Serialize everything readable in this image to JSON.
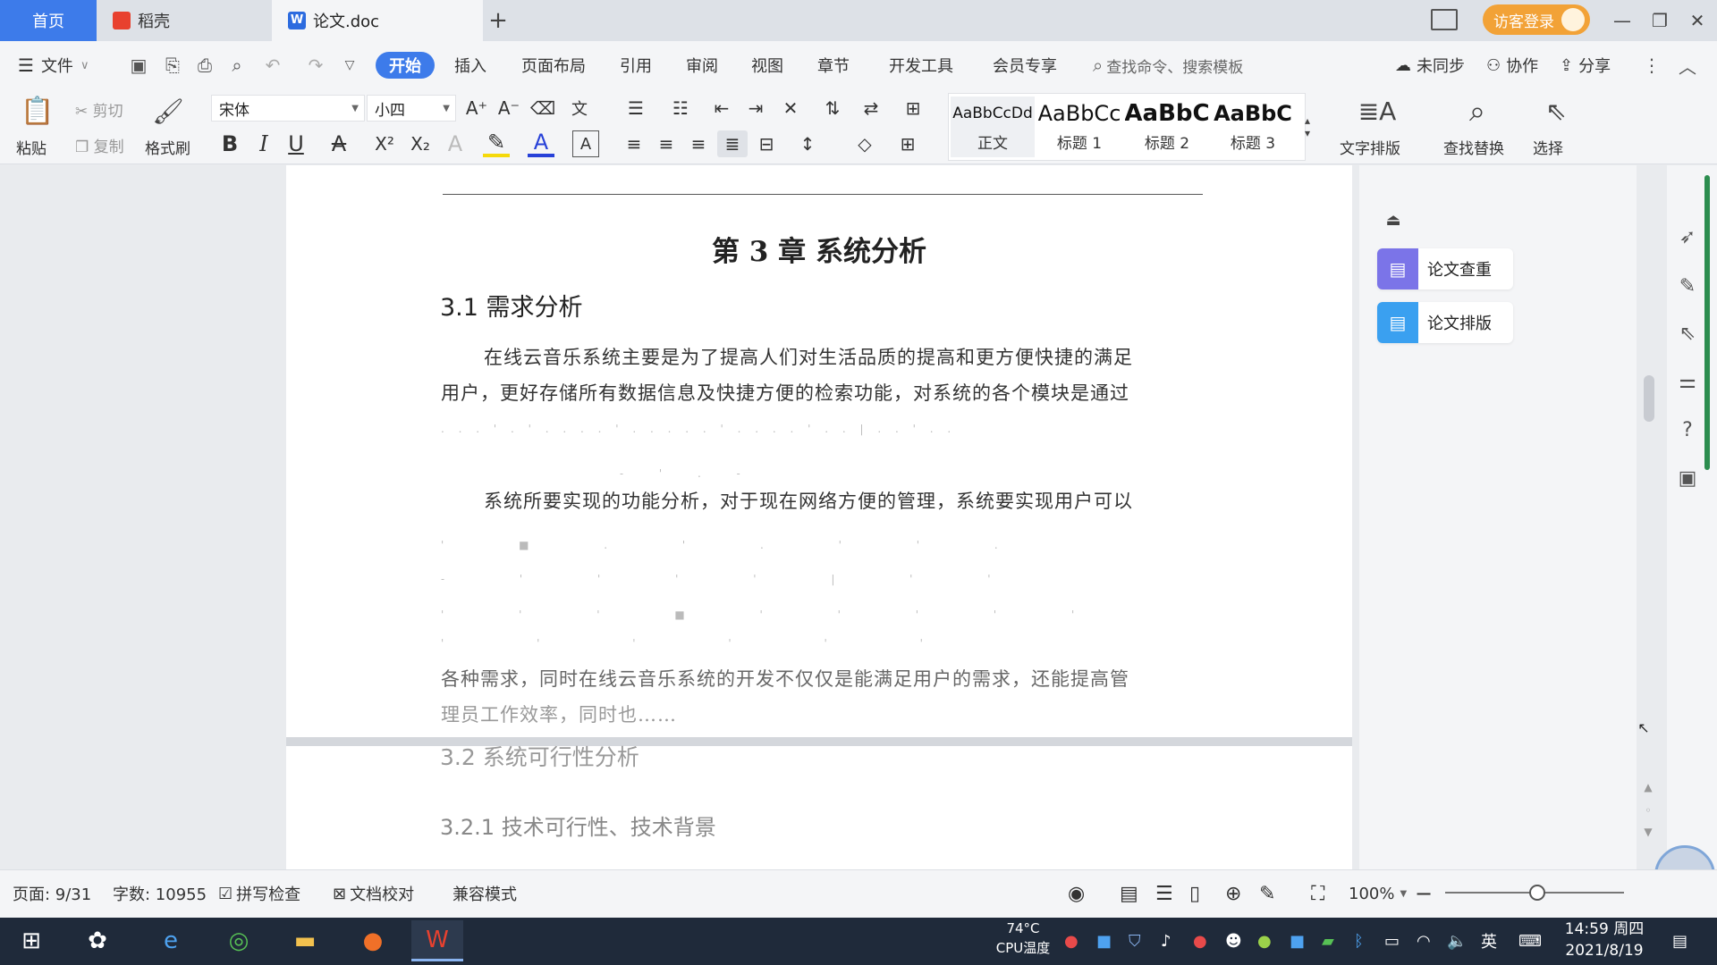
{
  "titlebar": {
    "tabs": [
      {
        "label": "首页"
      },
      {
        "label": "稻壳"
      },
      {
        "label": "论文.doc",
        "icon_text": "W"
      }
    ],
    "new_tab": "+",
    "login_label": "访客登录"
  },
  "menubar": {
    "file_label": "文件",
    "items": [
      "开始",
      "插入",
      "页面布局",
      "引用",
      "审阅",
      "视图",
      "章节",
      "开发工具",
      "会员专享"
    ],
    "search_placeholder": "查找命令、搜索模板",
    "sync_label": "未同步",
    "collab_label": "协作",
    "share_label": "分享"
  },
  "ribbon": {
    "paste_label": "粘贴",
    "cut_label": "剪切",
    "copy_label": "复制",
    "format_painter_label": "格式刷",
    "font_name": "宋体",
    "font_size": "小四",
    "styles": [
      {
        "preview": "AaBbCcDd",
        "name": "正文"
      },
      {
        "preview": "AaBbCc",
        "name": "标题 1"
      },
      {
        "preview": "AaBbC",
        "name": "标题 2"
      },
      {
        "preview": "AaBbC",
        "name": "标题 3"
      }
    ],
    "text_layout_label": "文字排版",
    "find_replace_label": "查找替换",
    "select_label": "选择",
    "format_glyphs": {
      "bold": "B",
      "italic": "I",
      "underline": "U",
      "superscript": "X²",
      "subscript": "X₂",
      "bigger": "A⁺",
      "smaller": "A⁻"
    }
  },
  "document": {
    "chapter_title": "第 3 章  系统分析",
    "section_1": "3.1  需求分析",
    "para_1_line_1": "在线云音乐系统主要是为了提高人们对生活品质的提高和更方便快捷的满足",
    "para_1_line_2": "用户，更好存储所有数据信息及快捷方便的检索功能，对系统的各个模块是通过",
    "para_2_line_1": "系统所要实现的功能分析，对于现在网络方便的管理，系统要实现用户可以",
    "para_3_line_1": "各种需求，同时在线云音乐系统的开发不仅仅是能满足用户的需求，还能提高管",
    "para_3_line_2": "理员工作效率，同时也……",
    "section_2": "3.2  系统可行性分析",
    "section_2_1": "3.2.1 技术可行性、技术背景"
  },
  "side_panel": {
    "paper_check_label": "论文查重",
    "paper_layout_label": "论文排版"
  },
  "statusbar": {
    "page_info": "页面: 9/31",
    "word_count": "字数: 10955",
    "spell_check": "拼写检查",
    "doc_proof": "文档校对",
    "compat_mode": "兼容模式",
    "zoom": "100%",
    "zoom_level": 1.0
  },
  "taskbar": {
    "temperature": "74°C",
    "cpu_label": "CPU温度",
    "ime_label": "英",
    "time": "14:59 周四",
    "date": "2021/8/19"
  },
  "colors": {
    "accent": "#3d7bea",
    "login_orange": "#f2a237",
    "paper_check": "#7b74e8",
    "paper_layout": "#3aa0f0",
    "taskbar": "#1f2a3a"
  }
}
